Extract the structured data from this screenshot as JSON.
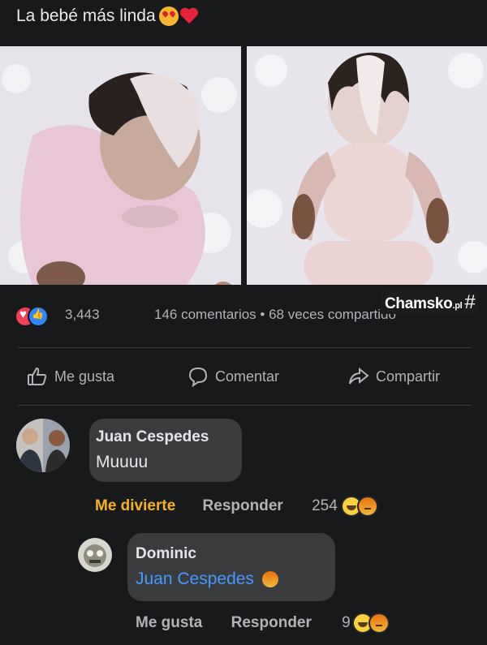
{
  "post": {
    "title": "La bebé más linda",
    "title_emojis": [
      "smiling-face-with-heart-eyes",
      "red-heart"
    ]
  },
  "photos": [
    {
      "name": "baby-photo-left"
    },
    {
      "name": "baby-photo-right"
    }
  ],
  "stats": {
    "reaction_types": [
      "love",
      "like"
    ],
    "reaction_count": "3,443",
    "comments_shares": "146 comentarios • 68 veces compartido"
  },
  "watermark": {
    "brand": "Chamsko",
    "suffix": ".pl",
    "symbol": "#"
  },
  "actions": {
    "like": "Me gusta",
    "comment": "Comentar",
    "share": "Compartir"
  },
  "comments": [
    {
      "author": "Juan Cespedes",
      "text": "Muuuu",
      "reaction_label": "Me divierte",
      "reply_label": "Responder",
      "reaction_count": "254"
    },
    {
      "author": "Dominic",
      "mention": "Juan Cespedes",
      "like_label": "Me gusta",
      "reply_label": "Responder",
      "reaction_count": "9"
    }
  ],
  "colors": {
    "background": "#18191b",
    "bubble": "#3a3b3c",
    "haha_label": "#f7b125",
    "mention": "#4599ff",
    "secondary_text": "#b0b3b8"
  }
}
